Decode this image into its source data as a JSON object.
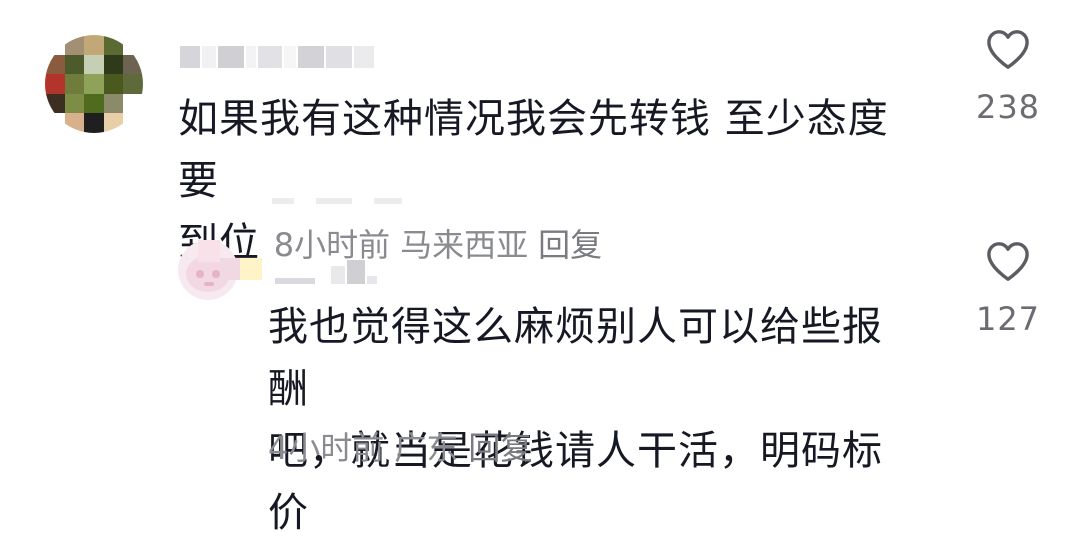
{
  "comments": [
    {
      "avatar_icon": "pixelated-avatar-icon",
      "text_line1": "如果我有这种情况我会先转钱 至少态度要",
      "text_line2": "到位",
      "time": "8小时前",
      "location": "马来西亚",
      "reply_label": "回复",
      "like_icon": "heart-outline-icon",
      "like_count": "238"
    },
    {
      "avatar_icon": "pink-avatar-icon",
      "text_line1": "我也觉得这么麻烦别人可以给些报酬",
      "text_line2": "吧，就当是花钱请人干活，明码标价",
      "time": "4小时前",
      "location": "广东",
      "reply_label": "回复",
      "like_icon": "heart-outline-icon",
      "like_count": "127"
    }
  ],
  "colors": {
    "text": "#161823",
    "meta": "#8a8b91",
    "like_count": "#6b6c72",
    "heart_stroke": "#5c5d63"
  }
}
